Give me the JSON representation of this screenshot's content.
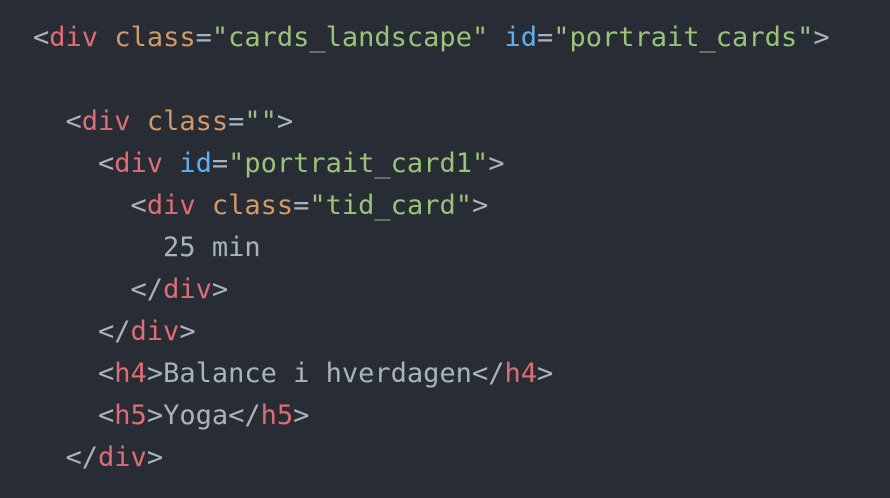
{
  "colors": {
    "background": "#282c34",
    "punctuation": "#abb2bf",
    "tag": "#e06c75",
    "attribute": "#d19a66",
    "id_attribute": "#61afef",
    "string": "#98c379",
    "text": "#abb2bf"
  },
  "code": {
    "line1": {
      "tag": "div",
      "attr1_name": "class",
      "attr1_value": "\"cards_landscape\"",
      "attr2_name": "id",
      "attr2_value": "\"portrait_cards\""
    },
    "line3": {
      "tag": "div",
      "attr_name": "class",
      "attr_value": "\"\""
    },
    "line4": {
      "tag": "div",
      "attr_name": "id",
      "attr_value": "\"portrait_card1\""
    },
    "line5": {
      "tag": "div",
      "attr_name": "class",
      "attr_value": "\"tid_card\""
    },
    "line6": {
      "text": "25 min"
    },
    "line7": {
      "tag": "div"
    },
    "line8": {
      "tag": "div"
    },
    "line9": {
      "tag": "h4",
      "text": "Balance i hverdagen"
    },
    "line10": {
      "tag": "h5",
      "text": "Yoga"
    },
    "line11": {
      "tag": "div"
    }
  }
}
